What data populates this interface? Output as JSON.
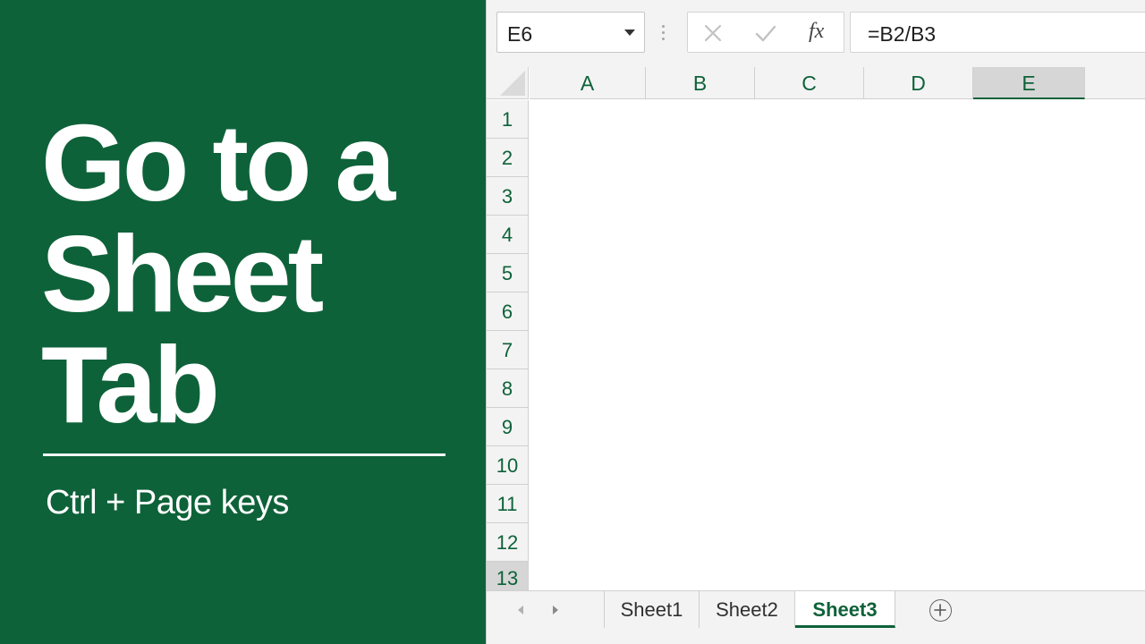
{
  "title_panel": {
    "title_lines": [
      "Go to a",
      "Sheet",
      "Tab"
    ],
    "subtitle": "Ctrl + Page keys",
    "background_color": "#0e6239"
  },
  "formula_bar": {
    "name_box": "E6",
    "fx_label": "fx",
    "formula": "=B2/B3",
    "icons": [
      "cancel-icon",
      "enter-icon",
      "fx-icon",
      "chevron-down-icon"
    ]
  },
  "grid": {
    "columns": [
      "A",
      "B",
      "C",
      "D",
      "E"
    ],
    "selected_column": "E",
    "rows": [
      "1",
      "2",
      "3",
      "4",
      "5",
      "6",
      "7",
      "8",
      "9",
      "10",
      "11",
      "12",
      "13"
    ],
    "selected_row": "13"
  },
  "sheet_tabs": {
    "tabs": [
      "Sheet1",
      "Sheet2",
      "Sheet3"
    ],
    "active": "Sheet3",
    "icons": [
      "scroll-left-icon",
      "scroll-right-icon",
      "add-sheet-icon"
    ]
  },
  "colors": {
    "accent": "#0e6239",
    "header_bg": "#f3f3f3",
    "selected_header_bg": "#d6d6d6"
  }
}
